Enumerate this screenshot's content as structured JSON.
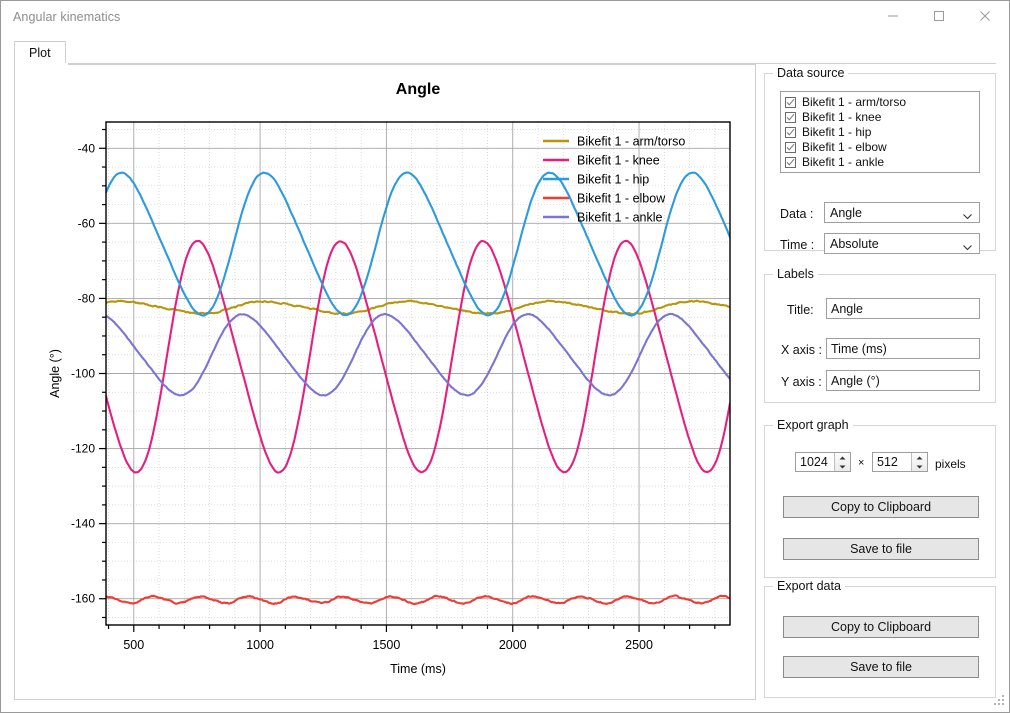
{
  "window": {
    "title": "Angular kinematics",
    "minimize_label": "minimize",
    "maximize_label": "maximize",
    "close_label": "close"
  },
  "tabs": [
    {
      "label": "Plot",
      "selected": true
    }
  ],
  "data_source": {
    "group_title": "Data source",
    "items": [
      {
        "label": "Bikefit 1 - arm/torso",
        "checked": true
      },
      {
        "label": "Bikefit 1 - knee",
        "checked": true
      },
      {
        "label": "Bikefit 1 - hip",
        "checked": true
      },
      {
        "label": "Bikefit 1 - elbow",
        "checked": true
      },
      {
        "label": "Bikefit 1 - ankle",
        "checked": true
      }
    ],
    "data_label": "Data :",
    "data_value": "Angle",
    "time_label": "Time :",
    "time_value": "Absolute"
  },
  "labels": {
    "group_title": "Labels",
    "title_label": "Title:",
    "title_value": "Angle",
    "xaxis_label": "X axis :",
    "xaxis_value": "Time (ms)",
    "yaxis_label": "Y axis :",
    "yaxis_value": "Angle (°)"
  },
  "export_graph": {
    "group_title": "Export graph",
    "width_value": "1024",
    "times_symbol": "×",
    "height_value": "512",
    "units_label": "pixels",
    "copy_label": "Copy to Clipboard",
    "save_label": "Save to file"
  },
  "export_data": {
    "group_title": "Export data",
    "copy_label": "Copy to Clipboard",
    "save_label": "Save to file"
  },
  "chart_data": {
    "type": "line",
    "title": "Angle",
    "xlabel": "Time (ms)",
    "ylabel": "Angle (°)",
    "xlim": [
      390,
      2860
    ],
    "ylim": [
      -167,
      -33
    ],
    "xticks": [
      500,
      1000,
      1500,
      2000,
      2500
    ],
    "yticks": [
      -40,
      -60,
      -80,
      -100,
      -120,
      -140,
      -160
    ],
    "minor_ticks": true,
    "grid": true,
    "legend_position": "top-right",
    "series": [
      {
        "name": "Bikefit 1 - arm/torso",
        "color": "#b8960c",
        "mean": -82.4,
        "amplitude": 1.6,
        "period_ms": 565,
        "phase_deg": 150,
        "noise": 0.35
      },
      {
        "name": "Bikefit 1 - knee",
        "color": "#e61f7f",
        "mean": -95.5,
        "amplitude": 30.0,
        "period_ms": 565,
        "phase_deg": 318,
        "noise": 0.2
      },
      {
        "name": "Bikefit 1 - hip",
        "color": "#2b9ade",
        "mean": -65.5,
        "amplitude": 18.5,
        "period_ms": 565,
        "phase_deg": 150,
        "noise": 0.2
      },
      {
        "name": "Bikefit 1 - elbow",
        "color": "#ef3c34",
        "mean": -160.3,
        "amplitude": 0.9,
        "period_ms": 188,
        "phase_deg": 60,
        "noise": 0.35
      },
      {
        "name": "Bikefit 1 - ankle",
        "color": "#7a74d4",
        "mean": -95.0,
        "amplitude": 10.5,
        "period_ms": 565,
        "phase_deg": 205,
        "noise": 0.2
      }
    ]
  }
}
